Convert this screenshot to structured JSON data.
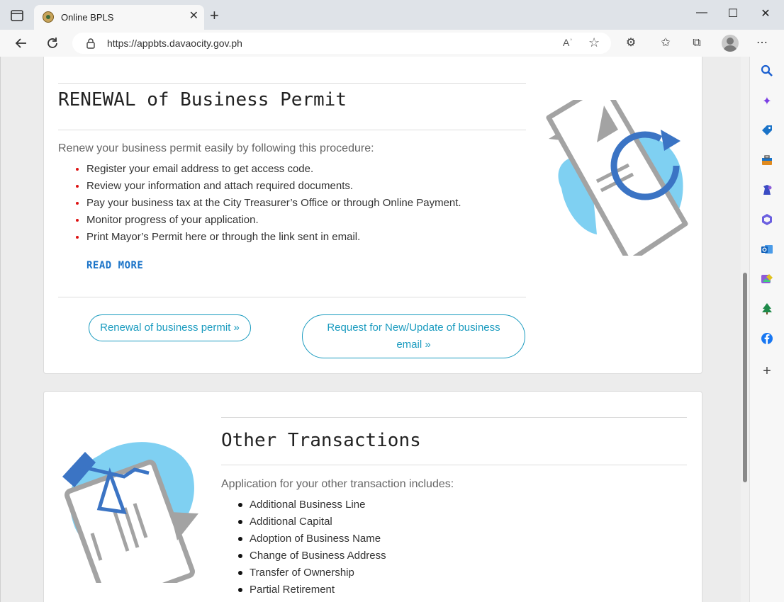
{
  "browser": {
    "tab_title": "Online BPLS",
    "tab_close": "✕",
    "new_tab": "+",
    "url": "https://appbts.davaocity.gov.ph",
    "read_aloud": "Aʾ",
    "window_min": "—",
    "window_max": "☐",
    "window_close": "✕"
  },
  "renewal": {
    "title": "RENEWAL of Business Permit",
    "intro": "Renew your business permit easily by following this procedure:",
    "steps": [
      "Register your email address to get access code.",
      "Review your information and attach required documents.",
      "Pay your business tax at the City Treasurer’s Office or through Online Payment.",
      "Monitor progress of your application.",
      "Print Mayor’s Permit here or through the link sent in email."
    ],
    "read_more": "READ MORE",
    "button_renewal": "Renewal of business permit »",
    "button_request_line1": "Request for New/Update of business",
    "button_request_line2": "email »"
  },
  "other": {
    "title": "Other Transactions",
    "intro": "Application for your other transaction includes:",
    "items": [
      "Additional Business Line",
      "Additional Capital",
      "Adoption of Business Name",
      "Change of Business Address",
      "Transfer of Ownership",
      "Partial Retirement"
    ]
  },
  "colors": {
    "accent_blue": "#1a73c8",
    "button_teal": "#1a9bbf",
    "bullet_red": "#dd1111",
    "illustration_blue": "#3b74c4",
    "illustration_lightblue": "#7fd0f2",
    "illustration_gray": "#a3a3a3"
  },
  "icons": {
    "sidebar": [
      "search-icon",
      "copilot-icon",
      "shopping-tag-icon",
      "toolbox-icon",
      "games-icon",
      "microsoft-365-icon",
      "outlook-icon",
      "image-creator-icon",
      "tree-icon",
      "facebook-icon",
      "add-icon"
    ]
  }
}
